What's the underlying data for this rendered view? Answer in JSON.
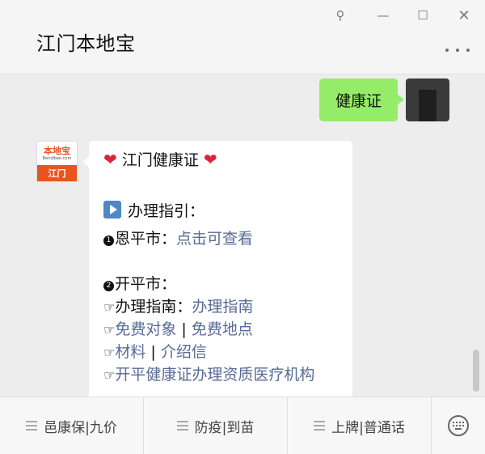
{
  "window": {
    "title": "江门本地宝",
    "pin_glyph": "⚲",
    "minimize_glyph": "—",
    "maximize_glyph": "☐",
    "close_glyph": "✕"
  },
  "chat": {
    "my_message": "健康证",
    "bot_avatar": {
      "logo_name": "本地宝",
      "logo_url": "Bendibao.com",
      "logo_city": "江门"
    },
    "bot_message": {
      "title": "江门健康证",
      "section_title": "办理指引：",
      "enping_number": "1",
      "enping_label": "恩平市：",
      "enping_link": "点击可查看",
      "kaiping_number": "2",
      "kaiping_label": "开平市：",
      "guide_label": "办理指南：",
      "guide_link": "办理指南",
      "free_target_link": "免费对象",
      "free_place_link": "免费地点",
      "material_link": "材料",
      "intro_letter_link": "介绍信",
      "institutions_link": "开平健康证办理资质医疗机构",
      "separator": " | ",
      "hand_glyph": "☞"
    }
  },
  "menu": {
    "items": [
      "邑康保|九价",
      "防疫|到苗",
      "上牌|普通话"
    ]
  },
  "icons": {
    "pin": "pin-icon",
    "minimize": "minimize-icon",
    "maximize": "maximize-icon",
    "close": "close-icon",
    "more": "more-icon",
    "heart": "heart-icon",
    "play": "play-icon",
    "hand": "pointing-hand-icon",
    "menu": "menu-lines-icon",
    "keyboard": "keyboard-icon"
  },
  "colors": {
    "my_bubble": "#95ec69",
    "link": "#576b95",
    "brand": "#e8541e"
  }
}
